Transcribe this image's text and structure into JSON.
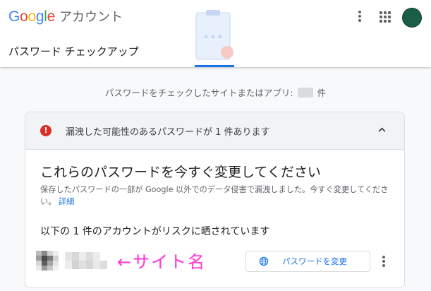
{
  "header": {
    "logo_letters": [
      "G",
      "o",
      "o",
      "g",
      "l",
      "e"
    ],
    "logo_colors": [
      "#4285f4",
      "#ea4335",
      "#fbbc05",
      "#4285f4",
      "#34a853",
      "#ea4335"
    ],
    "brand_suffix": "アカウント",
    "page_title": "パスワード チェックアップ",
    "icons": [
      "more-vert-icon",
      "apps-grid-icon",
      "avatar"
    ]
  },
  "summary": {
    "prefix": "パスワードをチェックしたサイトまたはアプリ:",
    "suffix": "件"
  },
  "card": {
    "header_text": "漏洩した可能性のあるパスワードが 1 件あります",
    "header_icon": "!",
    "title": "これらのパスワードを今すぐ変更してください",
    "description": "保存したパスワードの一部が Google 以外でのデータ侵害で漏洩しました。今すぐ変更してください。",
    "details_link": "詳細",
    "at_risk_text": "以下の 1 件のアカウントがリスクに晒されています",
    "site_annotation": "←サイト名",
    "change_button": "パスワードを変更"
  },
  "colors": {
    "error": "#d93025",
    "link": "#1a73e8",
    "annotation": "#ff3dd6",
    "avatar": "#1b5e48"
  }
}
